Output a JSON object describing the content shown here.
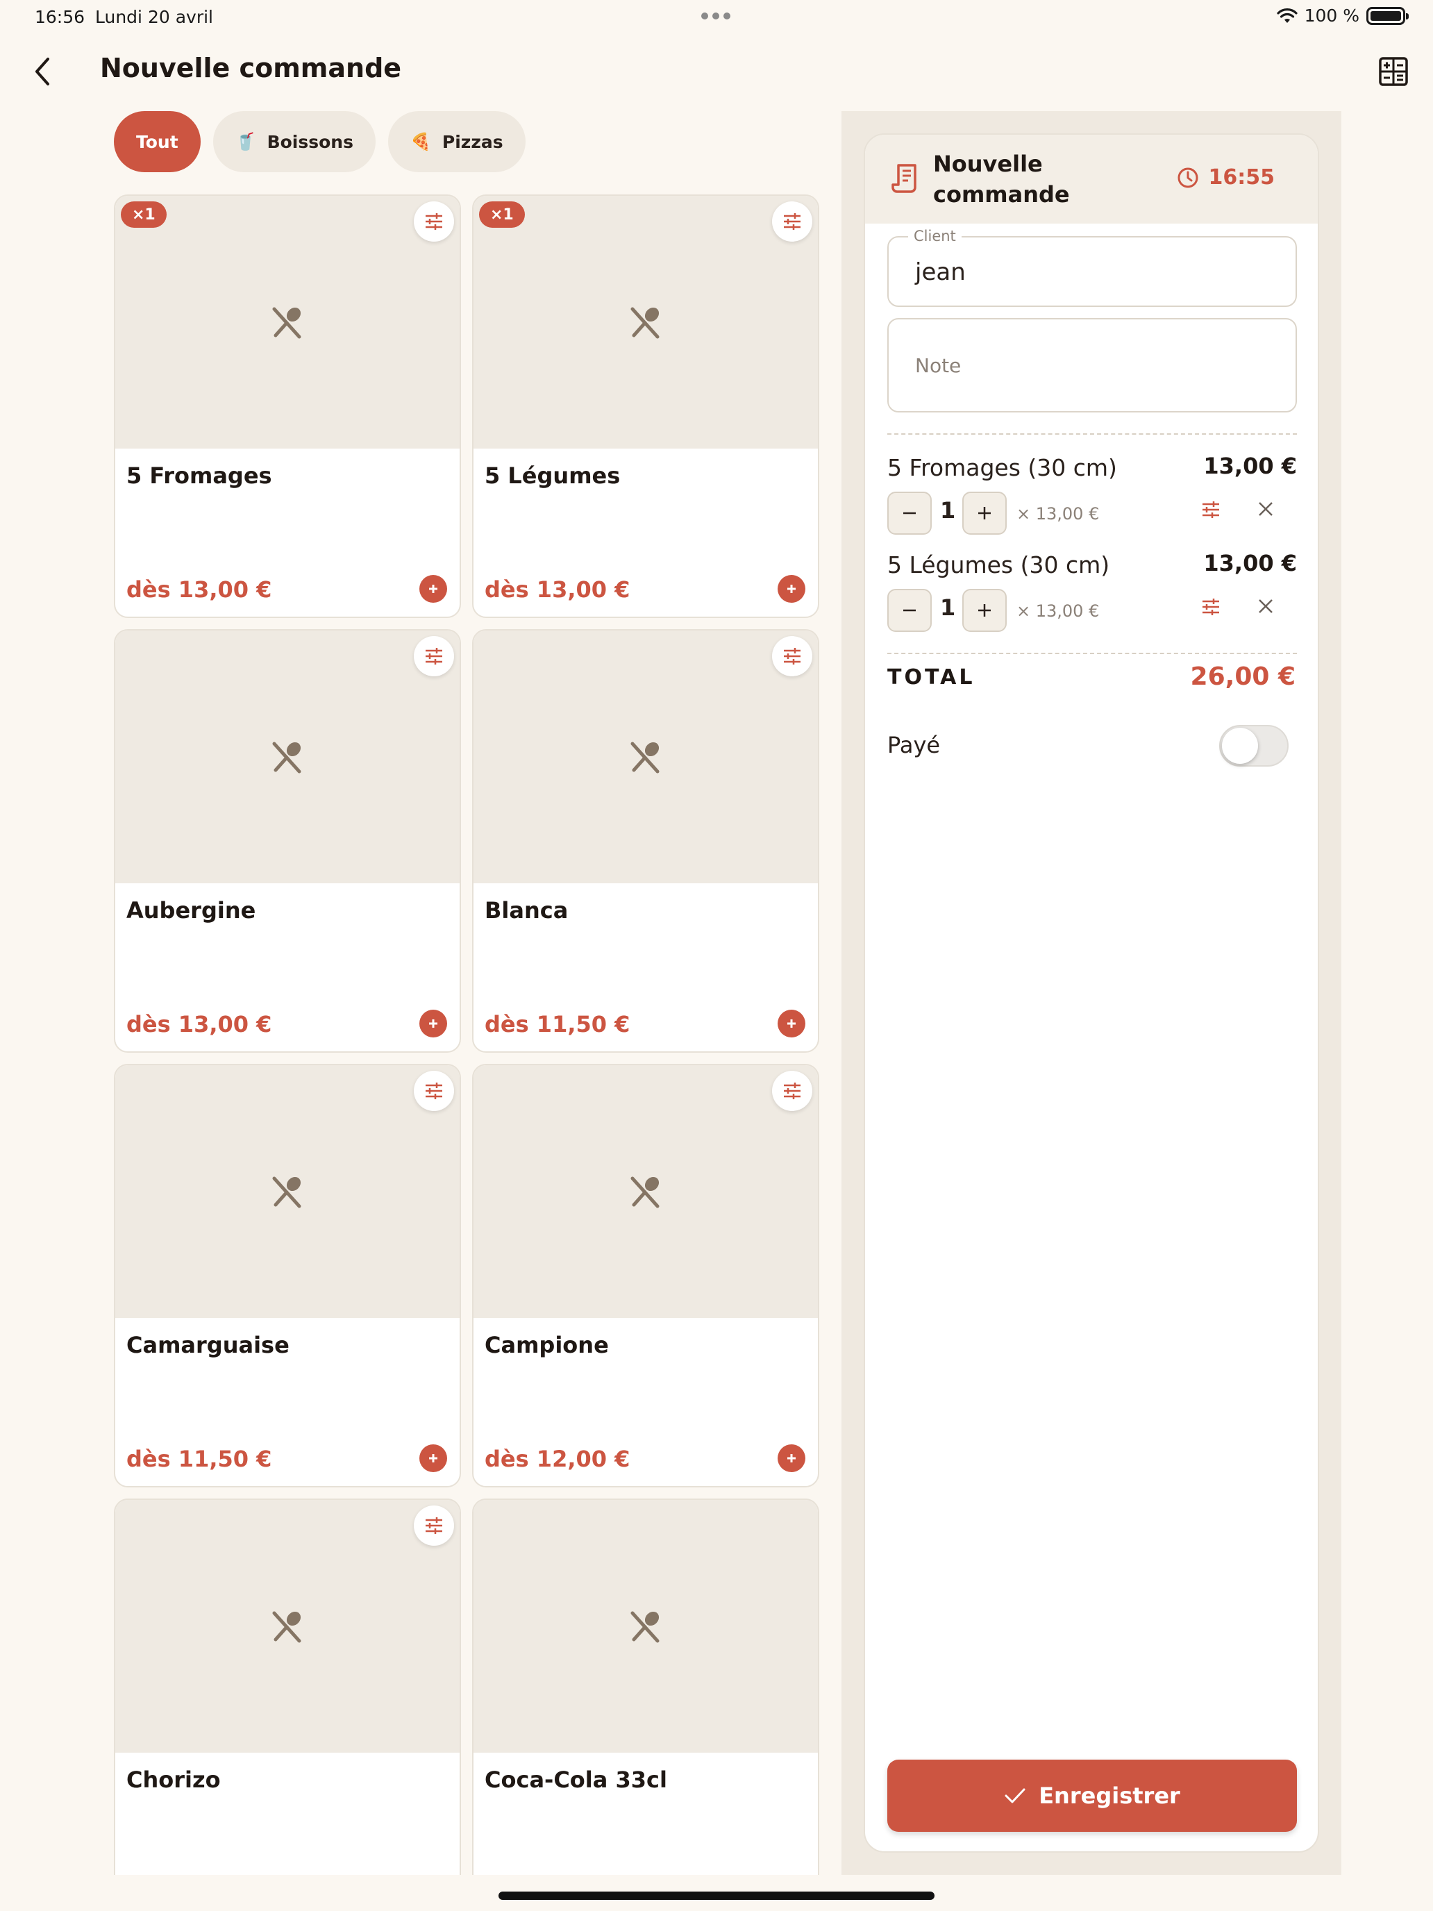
{
  "status_bar": {
    "time": "16:56",
    "date": "Lundi 20 avril",
    "battery": "100 %",
    "icons": [
      "wifi-icon",
      "battery-icon"
    ]
  },
  "header": {
    "title": "Nouvelle commande",
    "back_icon": "chevron-left-icon",
    "calculator_icon": "calculator-icon"
  },
  "categories": [
    {
      "label": "Tout",
      "icon": "",
      "active": true
    },
    {
      "label": "Boissons",
      "icon": "🥤",
      "active": false
    },
    {
      "label": "Pizzas",
      "icon": "🍕",
      "active": false
    }
  ],
  "products": [
    {
      "name": "5 Fromages",
      "price": "dès 13,00 €",
      "badge": "×1"
    },
    {
      "name": "5 Légumes",
      "price": "dès 13,00 €",
      "badge": "×1"
    },
    {
      "name": "Aubergine",
      "price": "dès 13,00 €",
      "badge": ""
    },
    {
      "name": "Blanca",
      "price": "dès 11,50 €",
      "badge": ""
    },
    {
      "name": "Camarguaise",
      "price": "dès 11,50 €",
      "badge": ""
    },
    {
      "name": "Campione",
      "price": "dès 12,00 €",
      "badge": ""
    },
    {
      "name": "Chorizo",
      "price": "",
      "badge": ""
    },
    {
      "name": "Coca-Cola 33cl",
      "price": "",
      "badge": ""
    }
  ],
  "order": {
    "title": "Nouvelle commande",
    "time": "16:55",
    "client_label": "Client",
    "client_value": "jean",
    "note_placeholder": "Note",
    "lines": [
      {
        "name": "5 Fromages (30 cm)",
        "total": "13,00 €",
        "qty": "1",
        "unit_price": "× 13,00 €"
      },
      {
        "name": "5 Légumes (30 cm)",
        "total": "13,00 €",
        "qty": "1",
        "unit_price": "× 13,00 €"
      }
    ],
    "total_label": "TOTAL",
    "total_value": "26,00 €",
    "paid_label": "Payé",
    "paid": false,
    "save_label": "Enregistrer"
  },
  "colors": {
    "accent": "#cc5541",
    "background": "#fbf7f1",
    "panel": "#efe9e0"
  }
}
